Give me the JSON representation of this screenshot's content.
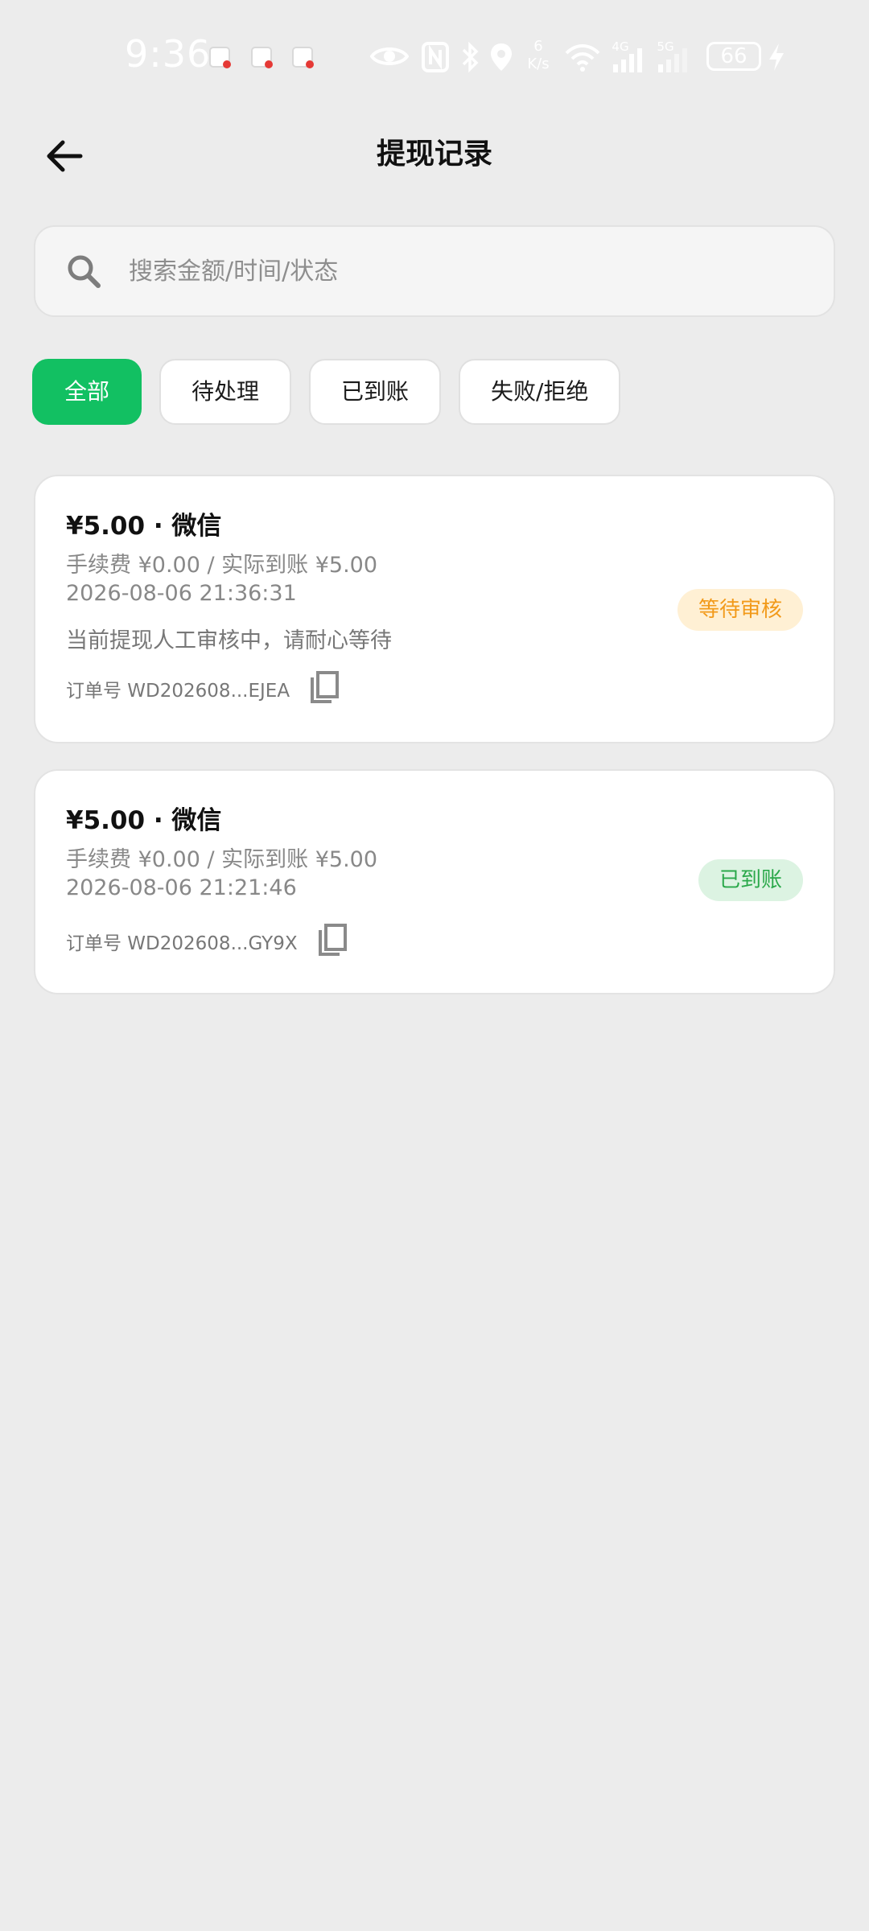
{
  "status_bar": {
    "time": "9:36",
    "network_speed_value": "6",
    "network_speed_unit": "K/s",
    "net_4g": "4G",
    "net_5g": "5G",
    "battery": "66"
  },
  "header": {
    "title": "提现记录"
  },
  "search": {
    "placeholder": "搜索金额/时间/状态"
  },
  "filters": [
    {
      "label": "全部",
      "active": true
    },
    {
      "label": "待处理",
      "active": false
    },
    {
      "label": "已到账",
      "active": false
    },
    {
      "label": "失败/拒绝",
      "active": false
    }
  ],
  "records": [
    {
      "amount_line": "¥5.00 · 微信",
      "fee_line": "手续费 ¥0.00 / 实际到账 ¥5.00",
      "time": "2026-08-06 21:36:31",
      "note": "当前提现人工审核中，请耐心等待",
      "order": "订单号 WD202608...EJEA",
      "status": "等待审核"
    },
    {
      "amount_line": "¥5.00 · 微信",
      "fee_line": "手续费 ¥0.00 / 实际到账 ¥5.00",
      "time": "2026-08-06 21:21:46",
      "order": "订单号 WD202608...GY9X",
      "status": "已到账"
    }
  ],
  "colors": {
    "accent": "#12c062",
    "pending_text": "#f29a1a",
    "pending_bg": "#fff0d4",
    "done_text": "#2aa84a",
    "done_bg": "#dcf3e2",
    "page_bg": "#ececec"
  },
  "icons": {
    "back": "arrow-left-icon",
    "search": "search-icon",
    "copy": "copy-icon"
  }
}
